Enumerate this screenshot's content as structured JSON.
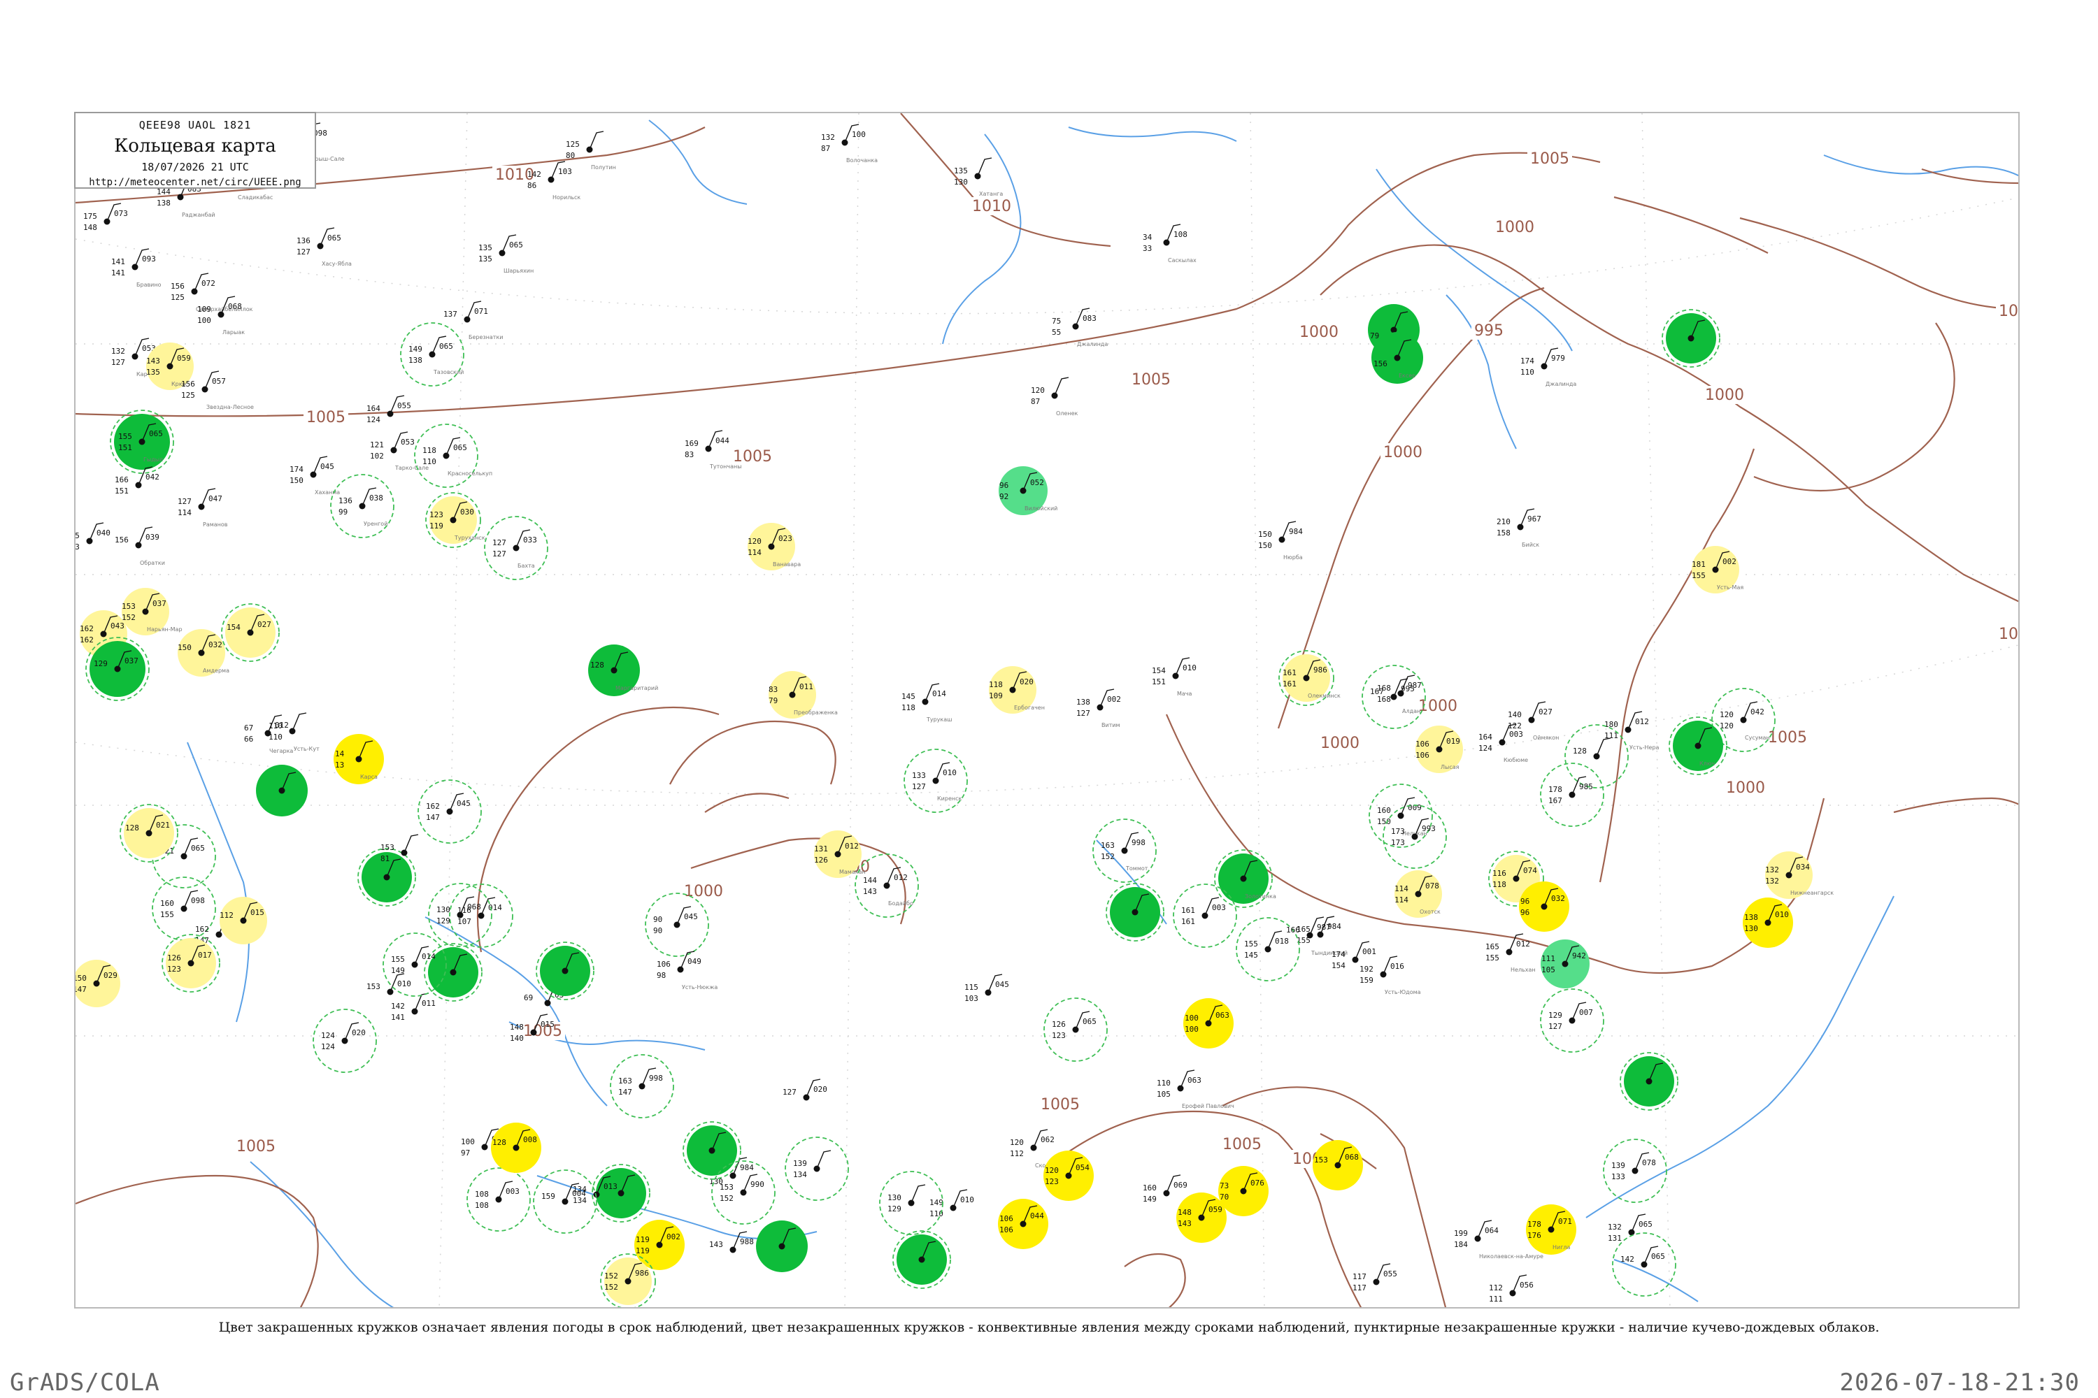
{
  "header": {
    "code_line": "QEEE98  UAOL  1821",
    "title": "Кольцевая карта",
    "date": "18/07/2026 21 UTC",
    "url": "http://meteocenter.net/circ/UEEE.png"
  },
  "caption": "Цвет закрашенных кружков означает явления погоды в срок наблюдений, цвет незакрашенных кружков - конвективные явления между сроками наблюдений, пунктирные незакрашенные кружки - наличие кучево-дождевых облаков.",
  "footer": {
    "brand": "GrADS/COLA",
    "timestamp": "2026-07-18-21:30"
  },
  "colors": {
    "isobar": "#a0624f",
    "river": "#5aa0e6",
    "rain_green": "#0ebc3a",
    "light_green": "#55de8a",
    "yellow": "#ffef00",
    "pale_yellow": "#fff59a",
    "cb_ring": "#3fbf55"
  },
  "isobar_labels": [
    {
      "text": "1010"
    },
    {
      "text": "1010"
    },
    {
      "text": "1005"
    },
    {
      "text": "1005"
    },
    {
      "text": "1005"
    },
    {
      "text": "1005"
    },
    {
      "text": "1000"
    },
    {
      "text": "1000"
    },
    {
      "text": "1000"
    },
    {
      "text": "995"
    },
    {
      "text": "1000"
    },
    {
      "text": "1000"
    },
    {
      "text": "1000"
    },
    {
      "text": "1005"
    },
    {
      "text": "1005"
    },
    {
      "text": "1005"
    },
    {
      "text": "1000"
    },
    {
      "text": "1000"
    },
    {
      "text": "1005"
    },
    {
      "text": "1005"
    },
    {
      "text": "1000"
    },
    {
      "text": "101"
    },
    {
      "text": "1005"
    },
    {
      "text": "1000"
    }
  ],
  "stations": [
    {
      "marker": "none",
      "t": "175",
      "p": "073",
      "td": "148",
      "name": ""
    },
    {
      "marker": "none",
      "t": "144",
      "p": "083",
      "td": "138",
      "name": "Раджанбай"
    },
    {
      "marker": "none",
      "t": "141",
      "p": "093",
      "td": "141",
      "name": "Бравино"
    },
    {
      "marker": "none",
      "t": "156",
      "p": "072",
      "td": "125",
      "name": "Самерхайбелиллок"
    },
    {
      "marker": "none",
      "t": "109",
      "p": "068",
      "td": "100",
      "name": "Ларыак"
    },
    {
      "marker": "none",
      "t": "132",
      "p": "053",
      "td": "127",
      "name": "Картарлы"
    },
    {
      "marker": "pale",
      "t": "143",
      "p": "059",
      "td": "135",
      "name": "Крюк"
    },
    {
      "marker": "none",
      "t": "156",
      "p": "057",
      "td": "125",
      "name": "Звездна-Лесное"
    },
    {
      "marker": "green-big",
      "t": "155",
      "p": "065",
      "td": "151",
      "name": "Гыдыл"
    },
    {
      "marker": "none",
      "t": "166",
      "p": "042",
      "td": "151",
      "name": ""
    },
    {
      "marker": "none",
      "t": "145",
      "p": "040",
      "td": "163",
      "name": ""
    },
    {
      "marker": "none",
      "t": "156",
      "p": "039",
      "td": "",
      "name": "Обратки"
    },
    {
      "marker": "none",
      "t": "127",
      "p": "047",
      "td": "114",
      "name": "Раманов"
    },
    {
      "marker": "none",
      "t": "174",
      "p": "045",
      "td": "150",
      "name": "Хаханма"
    },
    {
      "marker": "pale",
      "t": "153",
      "p": "037",
      "td": "152",
      "name": "Нарьян-Мар"
    },
    {
      "marker": "pale",
      "t": "162",
      "p": "043",
      "td": "162",
      "name": ""
    },
    {
      "marker": "green-big",
      "t": "129",
      "p": "037",
      "td": "",
      "name": ""
    },
    {
      "marker": "pale",
      "t": "150",
      "p": "032",
      "td": "",
      "name": "Амдерма"
    },
    {
      "marker": "pale-yellow",
      "t": "154",
      "p": "027",
      "td": "",
      "name": ""
    },
    {
      "marker": "none",
      "t": "148",
      "p": "098",
      "td": "",
      "name": "Барыш-Сале"
    },
    {
      "marker": "none",
      "t": "170",
      "p": "098",
      "td": "143",
      "name": "Сладикабас"
    },
    {
      "marker": "none",
      "t": "136",
      "p": "065",
      "td": "127",
      "name": "Хасу-Ябла"
    },
    {
      "marker": "none",
      "t": "142",
      "p": "103",
      "td": "86",
      "name": "Норильск"
    },
    {
      "marker": "none",
      "t": "135",
      "p": "065",
      "td": "135",
      "name": "Шарьяхин"
    },
    {
      "marker": "none",
      "t": "125",
      "p": "",
      "td": "80",
      "name": "Полутин"
    },
    {
      "marker": "none",
      "t": "132",
      "p": "100",
      "td": "87",
      "name": "Волочанка"
    },
    {
      "marker": "none",
      "t": "135",
      "p": "",
      "td": "130",
      "name": "Хатанга"
    },
    {
      "marker": "none",
      "t": "137",
      "p": "071",
      "td": "",
      "name": "Березнатки"
    },
    {
      "marker": "cb",
      "t": "149",
      "p": "065",
      "td": "138",
      "name": "Тазовский"
    },
    {
      "marker": "none",
      "t": "164",
      "p": "055",
      "td": "124",
      "name": ""
    },
    {
      "marker": "none",
      "t": "121",
      "p": "053",
      "td": "102",
      "name": "Тарко-Сале"
    },
    {
      "marker": "cb",
      "t": "118",
      "p": "065",
      "td": "110",
      "name": "Красноселькуп"
    },
    {
      "marker": "cb",
      "t": "136",
      "p": "038",
      "td": "99",
      "name": "Уренгой"
    },
    {
      "marker": "pale-cb",
      "t": "123",
      "p": "030",
      "td": "119",
      "name": "Туруханск"
    },
    {
      "marker": "cb",
      "t": "127",
      "p": "033",
      "td": "127",
      "name": "Бахта"
    },
    {
      "marker": "none",
      "t": "169",
      "p": "044",
      "td": "83",
      "name": "Тутончаны"
    },
    {
      "marker": "pale",
      "t": "120",
      "p": "023",
      "td": "114",
      "name": "Ванавара"
    },
    {
      "marker": "none",
      "t": "34",
      "p": "108",
      "td": "33",
      "name": "Саскылах"
    },
    {
      "marker": "none",
      "t": "75",
      "p": "083",
      "td": "55",
      "name": "Джалинда"
    },
    {
      "marker": "none",
      "t": "120",
      "p": "",
      "td": "87",
      "name": "Оленек"
    },
    {
      "marker": "lightgreen",
      "t": "96",
      "p": "052",
      "td": "92",
      "name": "Вилюйский"
    },
    {
      "marker": "green",
      "t": "",
      "p": "",
      "td": "79",
      "name": ""
    },
    {
      "marker": "green",
      "t": "",
      "p": "",
      "td": "156",
      "name": "Ексер"
    },
    {
      "marker": "none",
      "t": "174",
      "p": "979",
      "td": "110",
      "name": "Джалинда"
    },
    {
      "marker": "green-cb",
      "t": "",
      "p": "",
      "td": "",
      "name": ""
    },
    {
      "marker": "none",
      "t": "210",
      "p": "967",
      "td": "158",
      "name": "Бийск"
    },
    {
      "marker": "none",
      "t": "150",
      "p": "984",
      "td": "150",
      "name": "Нюрба"
    },
    {
      "marker": "pale",
      "t": "181",
      "p": "002",
      "td": "155",
      "name": "Усть-Мая"
    },
    {
      "marker": "green",
      "t": "128",
      "p": "",
      "td": "",
      "name": "Маргаритарий"
    },
    {
      "marker": "pale",
      "t": "118",
      "p": "020",
      "td": "109",
      "name": "Ербогачен"
    },
    {
      "marker": "none",
      "t": "145",
      "p": "014",
      "td": "118",
      "name": "Турукаш"
    },
    {
      "marker": "pale",
      "t": "83",
      "p": "011",
      "td": "79",
      "name": "Преображенка"
    },
    {
      "marker": "none",
      "t": "138",
      "p": "002",
      "td": "127",
      "name": "Витим"
    },
    {
      "marker": "none",
      "t": "154",
      "p": "010",
      "td": "151",
      "name": "Мача"
    },
    {
      "marker": "pale-cb",
      "t": "161",
      "p": "986",
      "td": "161",
      "name": "Олекминск"
    },
    {
      "marker": "none",
      "t": "168",
      "p": "987",
      "td": "168",
      "name": "Алдан"
    },
    {
      "marker": "cb",
      "t": "167",
      "p": "995",
      "td": "",
      "name": ""
    },
    {
      "marker": "none",
      "t": "164",
      "p": "003",
      "td": "124",
      "name": "Кюбюме"
    },
    {
      "marker": "none",
      "t": "140",
      "p": "027",
      "td": "122",
      "name": "Оймякон"
    },
    {
      "marker": "none",
      "t": "180",
      "p": "012",
      "td": "111",
      "name": "Усть-Нера"
    },
    {
      "marker": "cb",
      "t": "120",
      "p": "042",
      "td": "120",
      "name": "Сусуман"
    },
    {
      "marker": "green-cb",
      "t": "",
      "p": "",
      "td": "",
      "name": "Ключ"
    },
    {
      "marker": "cb",
      "t": "128",
      "p": "",
      "td": "",
      "name": ""
    },
    {
      "marker": "pale",
      "t": "106",
      "p": "019",
      "td": "106",
      "name": "Лысая"
    },
    {
      "marker": "cb",
      "t": "133",
      "p": "010",
      "td": "127",
      "name": "Киренск"
    },
    {
      "marker": "pale",
      "t": "131",
      "p": "012",
      "td": "126",
      "name": "Мамакан"
    },
    {
      "marker": "cb",
      "t": "144",
      "p": "012",
      "td": "143",
      "name": "Бодайбо"
    },
    {
      "marker": "cb",
      "t": "163",
      "p": "998",
      "td": "152",
      "name": "Томмот"
    },
    {
      "marker": "green-cb",
      "t": "",
      "p": "",
      "td": "",
      "name": "Золотинка"
    },
    {
      "marker": "none",
      "t": "165",
      "p": "984",
      "td": "155",
      "name": ""
    },
    {
      "marker": "cb",
      "t": "160",
      "p": "009",
      "td": "150",
      "name": "Нелькан"
    },
    {
      "marker": "cb",
      "t": "178",
      "p": "985",
      "td": "167",
      "name": ""
    },
    {
      "marker": "cb",
      "t": "173",
      "p": "993",
      "td": "173",
      "name": ""
    },
    {
      "marker": "pale-cb",
      "t": "116",
      "p": "074",
      "td": "118",
      "name": ""
    },
    {
      "marker": "yellow",
      "t": "96",
      "p": "032",
      "td": "96",
      "name": ""
    },
    {
      "marker": "pale",
      "t": "132",
      "p": "034",
      "td": "132",
      "name": "Нижнеангарск"
    },
    {
      "marker": "green-cb",
      "t": "",
      "p": "",
      "td": "",
      "name": ""
    },
    {
      "marker": "cb",
      "t": "161",
      "p": "003",
      "td": "161",
      "name": ""
    },
    {
      "marker": "cb",
      "t": "155",
      "p": "018",
      "td": "145",
      "name": ""
    },
    {
      "marker": "none",
      "t": "166",
      "p": "987",
      "td": "",
      "name": "Тындинский"
    },
    {
      "marker": "none",
      "t": "174",
      "p": "001",
      "td": "154",
      "name": ""
    },
    {
      "marker": "none",
      "t": "192",
      "p": "016",
      "td": "159",
      "name": "Усть-Юдома"
    },
    {
      "marker": "pale",
      "t": "114",
      "p": "078",
      "td": "114",
      "name": "Охотск"
    },
    {
      "marker": "none",
      "t": "165",
      "p": "012",
      "td": "155",
      "name": "Нельхан"
    },
    {
      "marker": "lightgreen",
      "t": "111",
      "p": "942",
      "td": "105",
      "name": ""
    },
    {
      "marker": "yellow",
      "t": "138",
      "p": "010",
      "td": "130",
      "name": ""
    },
    {
      "marker": "cb",
      "t": "129",
      "p": "007",
      "td": "127",
      "name": ""
    },
    {
      "marker": "green-cb",
      "t": "",
      "p": "",
      "td": "",
      "name": ""
    },
    {
      "marker": "cb",
      "t": "90",
      "p": "045",
      "td": "90",
      "name": ""
    },
    {
      "marker": "none",
      "t": "106",
      "p": "049",
      "td": "98",
      "name": "Усть-Нюкжа"
    },
    {
      "marker": "none",
      "t": "115",
      "p": "045",
      "td": "103",
      "name": ""
    },
    {
      "marker": "cb",
      "t": "126",
      "p": "065",
      "td": "123",
      "name": ""
    },
    {
      "marker": "yellow",
      "t": "100",
      "p": "063",
      "td": "100",
      "name": ""
    },
    {
      "marker": "none",
      "t": "110",
      "p": "063",
      "td": "105",
      "name": "Ерофей Павлович"
    },
    {
      "marker": "none",
      "t": "120",
      "p": "062",
      "td": "112",
      "name": "Сковородино"
    },
    {
      "marker": "yellow",
      "t": "120",
      "p": "054",
      "td": "123",
      "name": ""
    },
    {
      "marker": "none",
      "t": "160",
      "p": "069",
      "td": "149",
      "name": ""
    },
    {
      "marker": "yellow",
      "t": "148",
      "p": "059",
      "td": "143",
      "name": ""
    },
    {
      "marker": "yellow",
      "t": "73",
      "p": "076",
      "td": "70",
      "name": ""
    },
    {
      "marker": "yellow",
      "t": "153",
      "p": "068",
      "td": "",
      "name": ""
    },
    {
      "marker": "cb",
      "t": "139",
      "p": "078",
      "td": "133",
      "name": ""
    },
    {
      "marker": "none",
      "t": "199",
      "p": "064",
      "td": "184",
      "name": "Николаевск-на-Амуре"
    },
    {
      "marker": "yellow",
      "t": "178",
      "p": "071",
      "td": "176",
      "name": "Нигла"
    },
    {
      "marker": "none",
      "t": "132",
      "p": "065",
      "td": "131",
      "name": ""
    },
    {
      "marker": "cb",
      "t": "142",
      "p": "065",
      "td": "",
      "name": ""
    },
    {
      "marker": "none",
      "t": "117",
      "p": "055",
      "td": "117",
      "name": ""
    },
    {
      "marker": "none",
      "t": "112",
      "p": "056",
      "td": "111",
      "name": "Могочинский Завод"
    },
    {
      "marker": "yellow",
      "t": "106",
      "p": "044",
      "td": "106",
      "name": ""
    },
    {
      "marker": "none",
      "t": "149",
      "p": "010",
      "td": "110",
      "name": ""
    },
    {
      "marker": "green-cb",
      "t": "",
      "p": "",
      "td": "",
      "name": ""
    },
    {
      "marker": "cb",
      "t": "130",
      "p": "",
      "td": "129",
      "name": ""
    },
    {
      "marker": "cb",
      "t": "139",
      "p": "",
      "td": "134",
      "name": ""
    },
    {
      "marker": "none",
      "t": "147",
      "p": "984",
      "td": "130",
      "name": ""
    },
    {
      "marker": "green-cb",
      "t": "",
      "p": "",
      "td": "",
      "name": ""
    },
    {
      "marker": "cb",
      "t": "153",
      "p": "990",
      "td": "152",
      "name": ""
    },
    {
      "marker": "none",
      "t": "143",
      "p": "988",
      "td": "",
      "name": ""
    },
    {
      "marker": "green",
      "t": "",
      "p": "",
      "td": "",
      "name": ""
    },
    {
      "marker": "yellow",
      "t": "119",
      "p": "002",
      "td": "119",
      "name": ""
    },
    {
      "marker": "pale-cb",
      "t": "152",
      "p": "986",
      "td": "152",
      "name": ""
    },
    {
      "marker": "green-cb",
      "t": "",
      "p": "",
      "td": "",
      "name": ""
    },
    {
      "marker": "none",
      "t": "134",
      "p": "013",
      "td": "134",
      "name": ""
    },
    {
      "marker": "cb",
      "t": "159",
      "p": "004",
      "td": "",
      "name": ""
    },
    {
      "marker": "cb",
      "t": "108",
      "p": "003",
      "td": "108",
      "name": ""
    },
    {
      "marker": "none",
      "t": "100",
      "p": "029",
      "td": "97",
      "name": ""
    },
    {
      "marker": "yellow",
      "t": "128",
      "p": "008",
      "td": "",
      "name": ""
    },
    {
      "marker": "cb",
      "t": "163",
      "p": "998",
      "td": "147",
      "name": ""
    },
    {
      "marker": "none",
      "t": "127",
      "p": "020",
      "td": "",
      "name": ""
    },
    {
      "marker": "none",
      "t": "148",
      "p": "015",
      "td": "140",
      "name": ""
    },
    {
      "marker": "none",
      "t": "69",
      "p": "03",
      "td": "",
      "name": ""
    },
    {
      "marker": "green-cb",
      "t": "",
      "p": "",
      "td": "",
      "name": ""
    },
    {
      "marker": "green-cb",
      "t": "",
      "p": "",
      "td": "",
      "name": ""
    },
    {
      "marker": "cb",
      "t": "124",
      "p": "020",
      "td": "124",
      "name": ""
    },
    {
      "marker": "none",
      "t": "153",
      "p": "010",
      "td": "",
      "name": ""
    },
    {
      "marker": "none",
      "t": "142",
      "p": "011",
      "td": "141",
      "name": ""
    },
    {
      "marker": "cb",
      "t": "155",
      "p": "014",
      "td": "149",
      "name": ""
    },
    {
      "marker": "cb",
      "t": "116",
      "p": "014",
      "td": "107",
      "name": ""
    },
    {
      "marker": "cb",
      "t": "130",
      "p": "068",
      "td": "129",
      "name": ""
    },
    {
      "marker": "green-cb",
      "t": "",
      "p": "",
      "td": "",
      "name": ""
    },
    {
      "marker": "cb",
      "t": "162",
      "p": "045",
      "td": "147",
      "name": ""
    },
    {
      "marker": "cb",
      "t": "121",
      "p": "065",
      "td": "",
      "name": ""
    },
    {
      "marker": "none",
      "t": "153",
      "p": "",
      "td": "81",
      "name": ""
    },
    {
      "marker": "cb",
      "t": "160",
      "p": "098",
      "td": "155",
      "name": ""
    },
    {
      "marker": "none",
      "t": "162",
      "p": "",
      "td": "147",
      "name": ""
    },
    {
      "marker": "pale",
      "t": "112",
      "p": "015",
      "td": "",
      "name": ""
    },
    {
      "marker": "pale",
      "t": "150",
      "p": "029",
      "td": "147",
      "name": ""
    },
    {
      "marker": "pale-yellow",
      "t": "126",
      "p": "017",
      "td": "123",
      "name": ""
    },
    {
      "marker": "pale-yellow",
      "t": "128",
      "p": "021",
      "td": "",
      "name": ""
    },
    {
      "marker": "green",
      "t": "",
      "p": "",
      "td": "",
      "name": ""
    },
    {
      "marker": "yellow",
      "t": "14",
      "p": "",
      "td": "13",
      "name": "Карса"
    },
    {
      "marker": "none",
      "t": "110",
      "p": "",
      "td": "110",
      "name": "Усть-Кут"
    },
    {
      "marker": "none",
      "t": "67",
      "p": "012",
      "td": "66",
      "name": "Чегарка"
    }
  ]
}
